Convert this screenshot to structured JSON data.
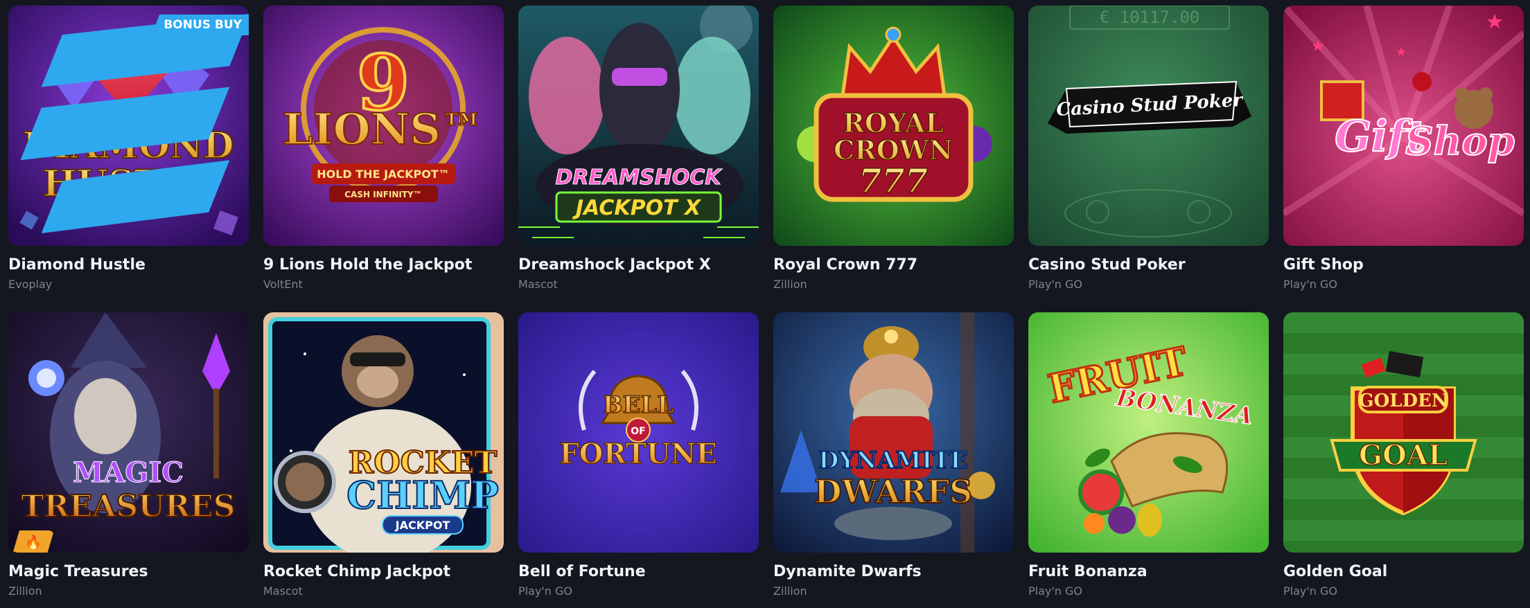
{
  "games": [
    {
      "title": "Diamond Hustle",
      "provider": "Evoplay",
      "logo": [
        "DIAMOND",
        "HUSTLE"
      ],
      "badge": "BONUS BUY"
    },
    {
      "title": "9 Lions Hold the Jackpot",
      "provider": "VoltEnt",
      "logo": [
        "9",
        "LIONS™",
        "HOLD THE JACKPOT™",
        "CASH INFINITY™"
      ]
    },
    {
      "title": "Dreamshock Jackpot X",
      "provider": "Mascot",
      "logo": [
        "DREAMSHOCK",
        "JACKPOT X"
      ]
    },
    {
      "title": "Royal Crown 777",
      "provider": "Zillion",
      "logo": [
        "ROYAL",
        "CROWN",
        "777"
      ]
    },
    {
      "title": "Casino Stud Poker",
      "provider": "Play'n GO",
      "logo": [
        "Casino Stud Poker",
        "€ 10117.00"
      ]
    },
    {
      "title": "Gift Shop",
      "provider": "Play'n GO",
      "logo": [
        "Gift",
        "Shop"
      ]
    },
    {
      "title": "Magic Treasures",
      "provider": "Zillion",
      "logo": [
        "MAGIC",
        "TREASURES"
      ]
    },
    {
      "title": "Rocket Chimp Jackpot",
      "provider": "Mascot",
      "logo": [
        "ROCKET",
        "CHIMP",
        "JACKPOT"
      ]
    },
    {
      "title": "Bell of Fortune",
      "provider": "Play'n GO",
      "logo": [
        "BELL",
        "OF",
        "FORTUNE"
      ]
    },
    {
      "title": "Dynamite Dwarfs",
      "provider": "Zillion",
      "logo": [
        "DYNAMITE",
        "DWARFS"
      ]
    },
    {
      "title": "Fruit Bonanza",
      "provider": "Play'n GO",
      "logo": [
        "FRUIT",
        "BONANZA"
      ]
    },
    {
      "title": "Golden Goal",
      "provider": "Play'n GO",
      "logo": [
        "GOLDEN",
        "GOAL"
      ]
    }
  ],
  "colors": {
    "background": "#141720",
    "title": "#f2f3f7",
    "provider": "#7f8493",
    "bonus_badge": "#2ea9f0",
    "hot_badge": "#f2a42a"
  },
  "icons": {
    "brand_mark": "evoplay-stripes-icon",
    "hot_badge": "flame-icon"
  }
}
